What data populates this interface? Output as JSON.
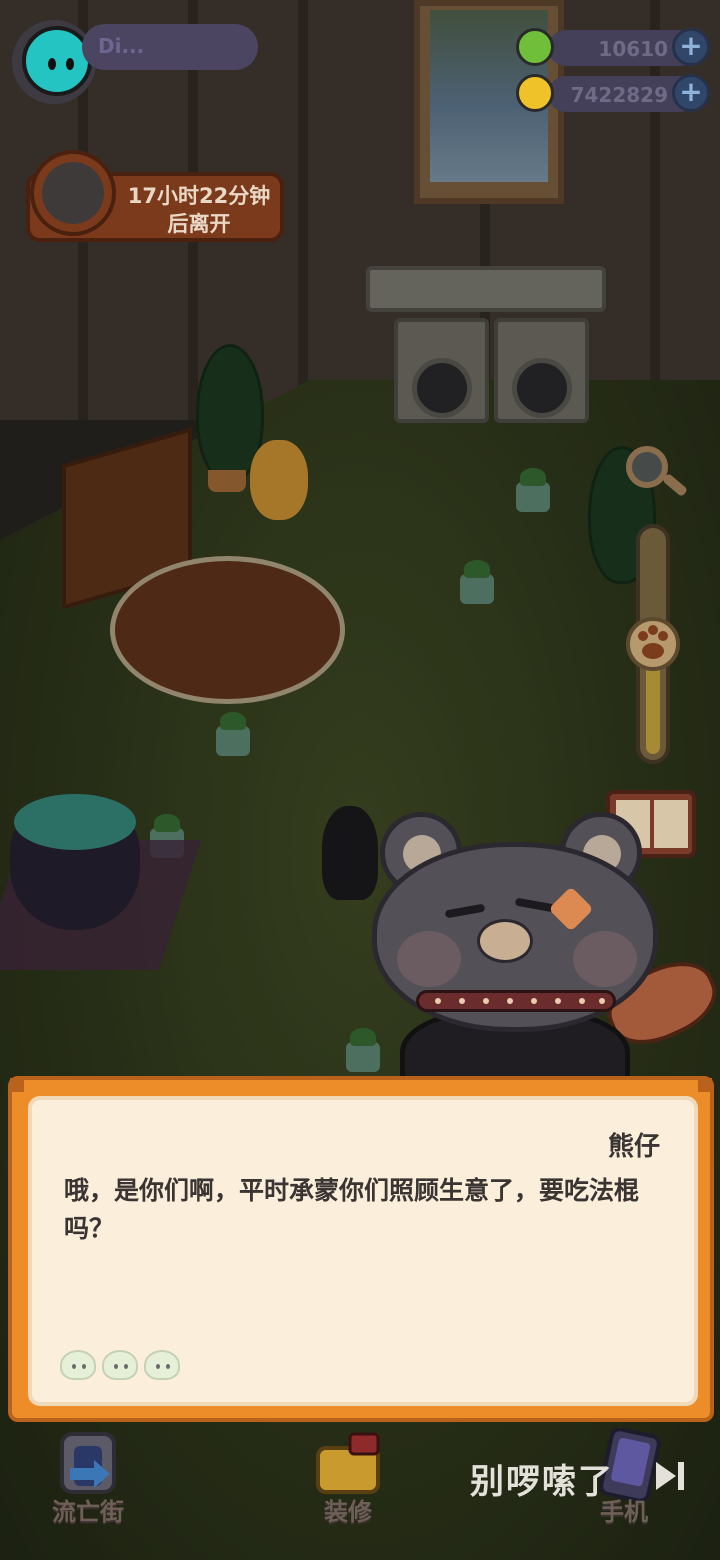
{
  "player": {
    "name": "Di..."
  },
  "currencies": [
    {
      "name": "green-coin",
      "value": "10610",
      "color": "#6fbf3a"
    },
    {
      "name": "yellow-duck",
      "value": "7422829",
      "color": "#f0c22a"
    }
  ],
  "visitor_timer": {
    "line1": "17小时22分钟",
    "line2": "后离开"
  },
  "zoom": {
    "level": 0.5
  },
  "dialog": {
    "speaker": "熊仔",
    "text": "哦，是你们啊，平时承蒙你们照顾生意了，要吃法棍吗？"
  },
  "bottom_nav": [
    {
      "label": "流亡街",
      "icon": "exile-street-icon"
    },
    {
      "label": "装修",
      "icon": "decorate-icon"
    },
    {
      "label": "手机",
      "icon": "phone-icon"
    }
  ],
  "skip": {
    "label": "别啰嗦了"
  },
  "colors": {
    "dialog_border": "#ec8d2a",
    "dialog_bg": "#fbefdc",
    "avatar": "#23c4c2"
  }
}
